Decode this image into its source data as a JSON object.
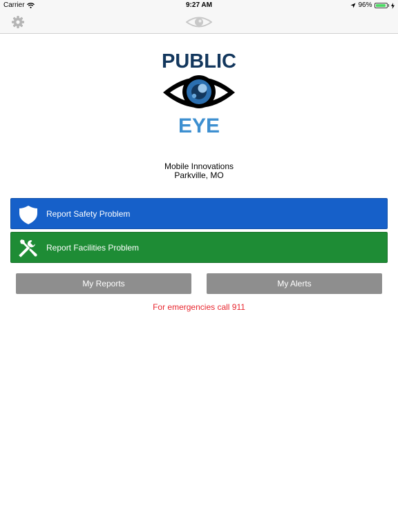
{
  "status_bar": {
    "carrier": "Carrier",
    "time": "9:27 AM",
    "battery_percent": "96%",
    "battery_level": 0.96
  },
  "logo": {
    "line1": "PUBLIC",
    "line2": "EYE"
  },
  "organization": {
    "name": "Mobile Innovations",
    "location": "Parkville, MO"
  },
  "actions": {
    "safety_label": "Report Safety Problem",
    "facilities_label": "Report Facilities Problem",
    "reports_label": "My Reports",
    "alerts_label": "My Alerts"
  },
  "emergency_text": "For emergencies call 911",
  "colors": {
    "safety": "#1660c9",
    "facilities": "#1e8c35",
    "secondary_button": "#8e8e8e",
    "emergency": "#e8262e",
    "logo_navy": "#13375d",
    "logo_blue": "#3d8fd0"
  },
  "icons": {
    "settings": "gear-icon",
    "title": "eye-icon",
    "safety": "shield-icon",
    "facilities": "wrench-screwdriver-icon"
  }
}
